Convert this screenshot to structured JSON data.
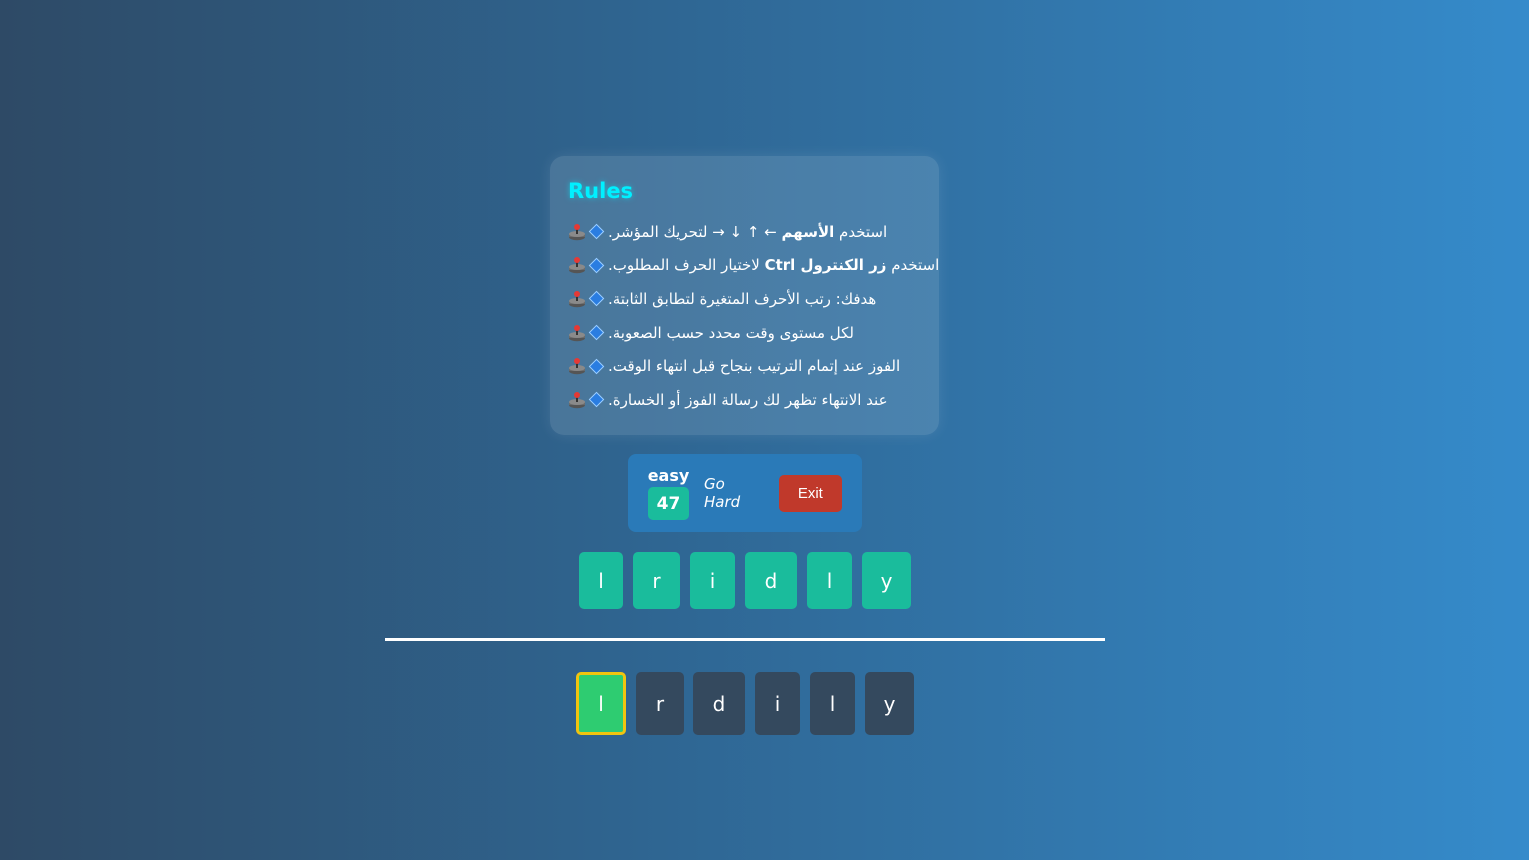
{
  "rules": {
    "title": "Rules",
    "items": [
      {
        "pre": "استخدم ",
        "bold": "الأسهم",
        "post": " ← ↑ ↓ → لتحريك المؤشر."
      },
      {
        "pre": "استخدم ",
        "bold": "زر الكنترول Ctrl",
        "post": " لاختيار الحرف المطلوب."
      },
      {
        "pre": "",
        "bold": "",
        "post": "هدفك: رتب الأحرف المتغيرة لتطابق الثابتة."
      },
      {
        "pre": "",
        "bold": "",
        "post": "لكل مستوى وقت محدد حسب الصعوبة."
      },
      {
        "pre": "",
        "bold": "",
        "post": "الفوز عند إتمام الترتيب بنجاح قبل انتهاء الوقت."
      },
      {
        "pre": "",
        "bold": "",
        "post": "عند الانتهاء تظهر لك رسالة الفوز أو الخسارة."
      }
    ],
    "icons": [
      "joystick-icon",
      "diamond-icon"
    ]
  },
  "controls": {
    "level": "easy",
    "timer": "47",
    "go_hard_label": "Go Hard",
    "exit_label": "Exit"
  },
  "target_word": [
    "l",
    "r",
    "i",
    "d",
    "l",
    "y"
  ],
  "player_word": [
    "l",
    "r",
    "d",
    "i",
    "l",
    "y"
  ],
  "cursor_index": 0,
  "colors": {
    "accent_title": "#00f0ff",
    "target_tile": "#1abc9c",
    "player_tile": "#34495e",
    "selected_tile": "#2ecc71",
    "selected_border": "#f1c40f",
    "exit_button": "#c0392b",
    "panel": "#2a7ab8"
  }
}
